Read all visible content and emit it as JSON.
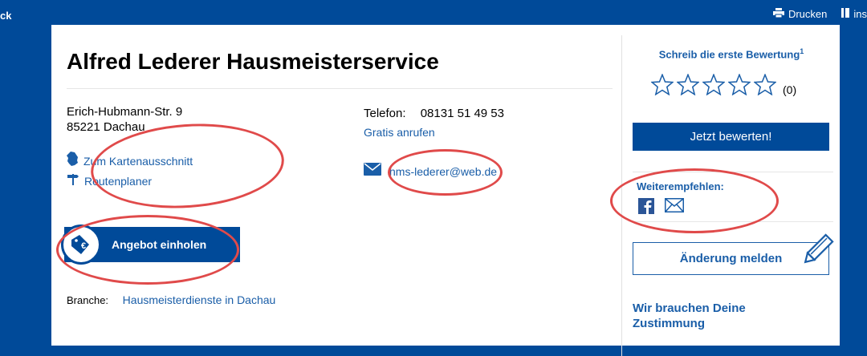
{
  "topbar": {
    "left_text": "ck",
    "print_label": "Drucken",
    "insert_label": "ins"
  },
  "business": {
    "name": "Alfred Lederer Hausmeisterservice",
    "street": "Erich-Hubmann-Str. 9",
    "city": "85221 Dachau",
    "map_link": "Zum Kartenausschnitt",
    "route_link": "Routenplaner",
    "phone_label": "Telefon:",
    "phone_number": "08131 51 49 53",
    "free_call": "Gratis anrufen",
    "email": "hms-lederer@web.de",
    "offer_button": "Angebot einholen",
    "branche_label": "Branche:",
    "branche_value": "Hausmeisterdienste in Dachau"
  },
  "sidebar": {
    "rating_title": "Schreib die erste Bewertung",
    "rating_sup": "1",
    "rating_count": "(0)",
    "rating_stars": 0,
    "rate_button": "Jetzt bewerten!",
    "recommend_title": "Weiterempfehlen:",
    "change_button": "Änderung melden",
    "consent_title": "Wir brauchen Deine Zustimmung"
  },
  "colors": {
    "brand_blue": "#004a99",
    "link_blue": "#1a5ea8",
    "annotation_red": "#e04a4a"
  },
  "icons": [
    "printer-icon",
    "bookmark-icon",
    "map-region-icon",
    "signpost-icon",
    "envelope-icon",
    "euro-tag-icon",
    "star-icon",
    "facebook-icon",
    "mail-icon",
    "pencil-icon"
  ]
}
